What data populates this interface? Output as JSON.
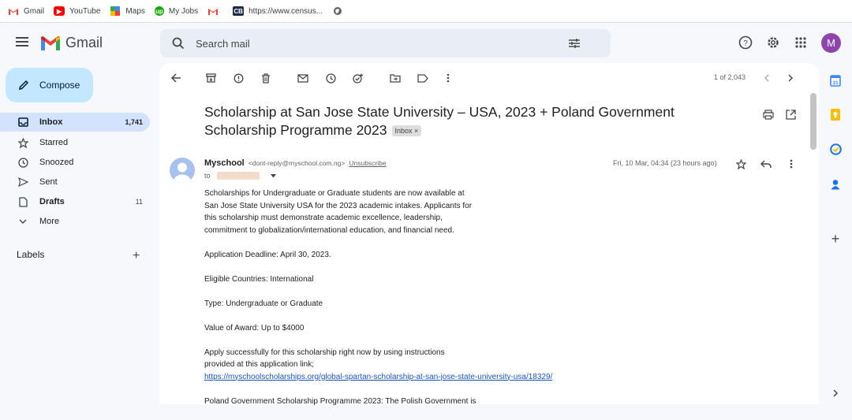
{
  "bookmarks": [
    {
      "label": "Gmail",
      "icon": "gmail-icon"
    },
    {
      "label": "YouTube",
      "icon": "youtube-icon"
    },
    {
      "label": "Maps",
      "icon": "maps-icon"
    },
    {
      "label": "My Jobs",
      "icon": "upwork-icon"
    },
    {
      "label": "",
      "icon": "gmail-icon"
    },
    {
      "label": "https://www.census...",
      "icon": "census-icon"
    },
    {
      "label": "",
      "icon": "globe-icon"
    }
  ],
  "app": {
    "name": "Gmail",
    "user_initial": "M"
  },
  "search": {
    "placeholder": "Search mail"
  },
  "sidebar": {
    "compose_label": "Compose",
    "items": [
      {
        "label": "Inbox",
        "count": "1,741"
      },
      {
        "label": "Starred",
        "count": ""
      },
      {
        "label": "Snoozed",
        "count": ""
      },
      {
        "label": "Sent",
        "count": ""
      },
      {
        "label": "Drafts",
        "count": "11"
      },
      {
        "label": "More",
        "count": ""
      }
    ],
    "labels_title": "Labels"
  },
  "toolbar": {
    "pager": "1 of 2,043"
  },
  "email": {
    "subject": "Scholarship at San Jose State University – USA, 2023 + Poland Government Scholarship Programme 2023",
    "label_chip": "Inbox ×",
    "sender_name": "Myschool",
    "sender_email": "<dont-reply@myschool.com.ng>",
    "unsubscribe": "Unsubscribe",
    "to_label": "to",
    "date": "Fri, 10 Mar, 04:34 (23 hours ago)",
    "body": {
      "p1_l1": "Scholarships for Undergraduate or Graduate students are now available at",
      "p1_l2": "San Jose State University USA for the 2023 academic intakes. Applicants for",
      "p1_l3": "this scholarship must demonstrate academic excellence, leadership,",
      "p1_l4": "commitment to globalization/international education, and financial need.",
      "p2": "Application Deadline: April 30, 2023.",
      "p3": "Eligible Countries: International",
      "p4": "Type: Undergraduate or Graduate",
      "p5": "Value of Award: Up to $4000",
      "p6_l1": "Apply successfully for this scholarship right now by using instructions",
      "p6_l2": "provided at this application link;",
      "link": "https://myschoolscholarships.org/global-spartan-scholarship-at-san-jose-state-university-usa/18329/",
      "p7": "Poland Government Scholarship Programme 2023: The Polish Government is"
    }
  },
  "colors": {
    "accent": "#c2e7ff",
    "active_nav": "#d3e3fd",
    "avatar": "#8e44ad"
  }
}
